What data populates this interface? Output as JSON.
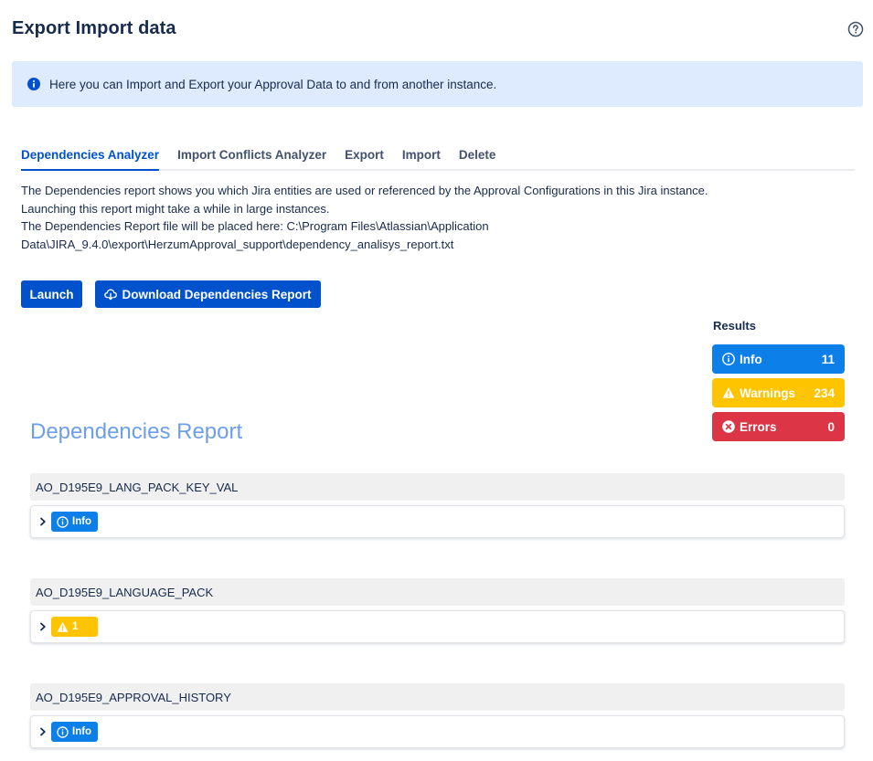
{
  "page": {
    "title": "Export Import data"
  },
  "banner": {
    "text": "Here you can Import and Export your Approval Data to and from another instance."
  },
  "tabs": [
    {
      "label": "Dependencies Analyzer",
      "active": true
    },
    {
      "label": "Import Conflicts Analyzer",
      "active": false
    },
    {
      "label": "Export",
      "active": false
    },
    {
      "label": "Import",
      "active": false
    },
    {
      "label": "Delete",
      "active": false
    }
  ],
  "description": {
    "line1": "The Dependencies report shows you which Jira entities are used or referenced by the Approval Configurations in this Jira instance.",
    "line2": "Launching this report might take a while in large instances.",
    "line3": "The Dependencies Report file will be placed here: C:\\Program Files\\Atlassian\\Application",
    "line4": "Data\\JIRA_9.4.0\\export\\HerzumApproval_support\\dependency_analisys_report.txt"
  },
  "buttons": {
    "launch": "Launch",
    "download": "Download Dependencies Report"
  },
  "results": {
    "label": "Results",
    "info": {
      "label": "Info",
      "count": "11",
      "color": "#0c7fe8"
    },
    "warnings": {
      "label": "Warnings",
      "count": "234",
      "color": "#ffc400"
    },
    "errors": {
      "label": "Errors",
      "count": "0",
      "color": "#dc3545"
    }
  },
  "report": {
    "title": "Dependencies Report",
    "sections": [
      {
        "name": "AO_D195E9_LANG_PACK_KEY_VAL",
        "badge_type": "info",
        "badge_label": "Info"
      },
      {
        "name": "AO_D195E9_LANGUAGE_PACK",
        "badge_type": "warning",
        "badge_label": "1"
      },
      {
        "name": "AO_D195E9_APPROVAL_HISTORY",
        "badge_type": "info",
        "badge_label": "Info"
      }
    ]
  },
  "colors": {
    "primary": "#0052cc",
    "banner_bg": "#deebff",
    "report_title": "#6c9fe8"
  },
  "icons": {
    "help": "question-circle-icon",
    "banner": "info-circle-icon",
    "download": "cloud-download-icon",
    "info": "info-circle-icon",
    "warning": "warning-triangle-icon",
    "error": "x-circle-icon",
    "expand": "chevron-right-icon"
  }
}
